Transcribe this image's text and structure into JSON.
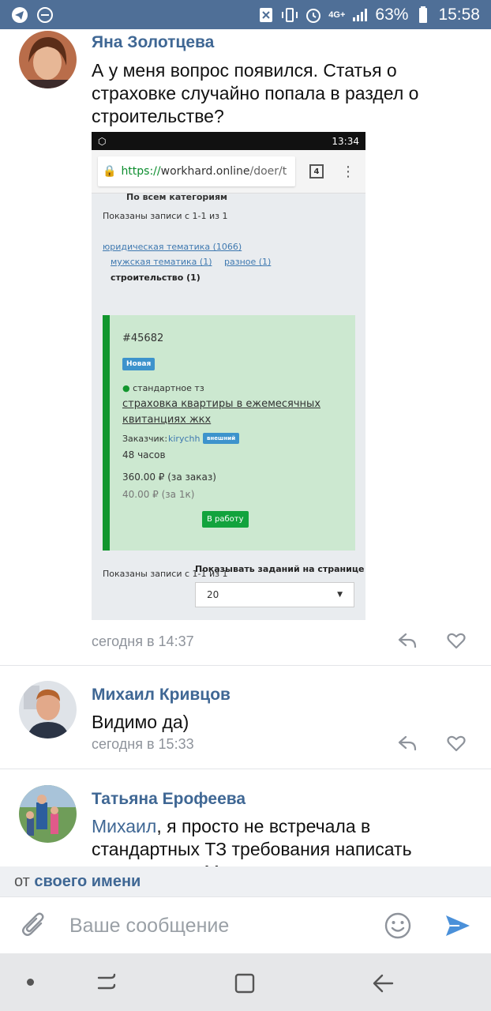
{
  "status_bar": {
    "network": "4G+",
    "battery": "63%",
    "time": "15:58"
  },
  "comments": [
    {
      "author": "Яна Золотцева",
      "text": "А у меня вопрос появился. Статья о страховке случайно попала в раздел о строительстве?",
      "time": "сегодня в 14:37"
    },
    {
      "author": "Михаил Кривцов",
      "text": "Видимо да)",
      "time": "сегодня в 15:33"
    },
    {
      "author": "Татьяна Ерофеева",
      "mention": "Михаил",
      "text": ", я просто не встречала в стандартных ТЗ требования написать дескрипшин. Может просто такие"
    }
  ],
  "attachment": {
    "time": "13:34",
    "url_secure": "https://",
    "url_host": "workhard.online",
    "url_path": "/doer/t",
    "tab_count": "4",
    "filter_all": "По всем категориям",
    "shown_top": "Показаны записи с 1-1 из 1",
    "cat_legal": "юридическая тематика (1066)",
    "cat_men": "мужская тематика (1)",
    "cat_misc": "разное (1)",
    "cat_build": "строительство (1)",
    "task_id": "#45682",
    "badge_new": "Новая",
    "spec_type": "стандартное тз",
    "task_title_1": "страховка квартиры в ежемесячных",
    "task_title_2": "квитанциях жкх",
    "customer_label": "Заказчик:",
    "customer_name": "kirychh",
    "badge_external": "внешний",
    "hours": "48 часов",
    "price_total": "360.00 ₽ (за заказ)",
    "price_per_k": "40.00 ₽ (за 1к)",
    "take_button": "В работу",
    "shown_bottom": "Показаны записи с 1-1 из 1",
    "per_page_label": "Показывать заданий на странице",
    "per_page_value": "20"
  },
  "footer": {
    "from_prefix": "от",
    "from_value": "своего имени",
    "message_placeholder": "Ваше сообщение"
  },
  "colors": {
    "status_bar": "#4f6f97",
    "author": "#3f6794",
    "send": "#4a90d9"
  }
}
